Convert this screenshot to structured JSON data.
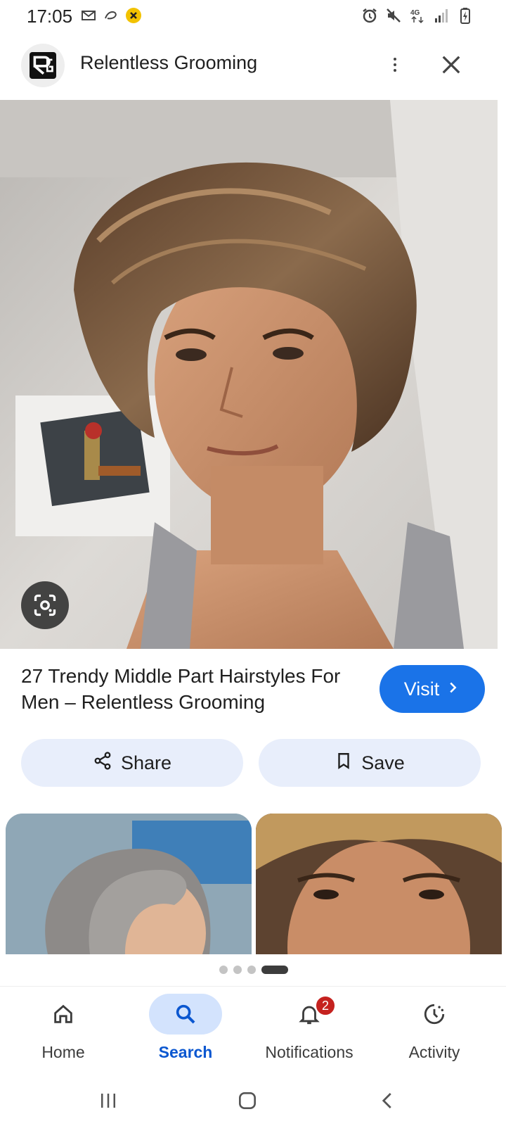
{
  "status_bar": {
    "time": "17:05",
    "left_icons": [
      "gmail-icon",
      "link-icon",
      "app-notification-icon"
    ],
    "right_icons": [
      "alarm-icon",
      "mute-icon",
      "network-4g-icon",
      "signal-icon",
      "battery-charging-icon"
    ],
    "network_label": "4G"
  },
  "header": {
    "source_name": "Relentless Grooming",
    "logo_text": "RG"
  },
  "result": {
    "title": "27 Trendy Middle Part Hairstyles For Men – Relentless Grooming",
    "visit_label": "Visit",
    "share_label": "Share",
    "save_label": "Save"
  },
  "pager": {
    "count": 4,
    "active_index": 3
  },
  "bottom_nav": {
    "items": [
      {
        "label": "Home",
        "icon": "home-icon",
        "active": false
      },
      {
        "label": "Search",
        "icon": "search-icon",
        "active": true
      },
      {
        "label": "Notifications",
        "icon": "bell-icon",
        "active": false,
        "badge": "2"
      },
      {
        "label": "Activity",
        "icon": "activity-icon",
        "active": false
      }
    ]
  },
  "colors": {
    "accent": "#1a73e8",
    "active_nav": "#0b57d0",
    "active_nav_bg": "#d3e3fd",
    "chip_bg": "#e8eefb",
    "badge": "#c5221f"
  }
}
